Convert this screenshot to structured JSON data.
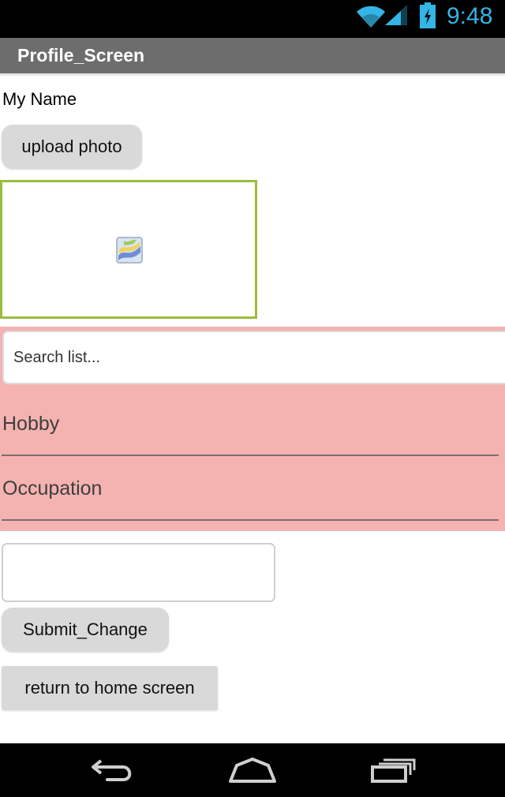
{
  "status_bar": {
    "time": "9:48",
    "icons": [
      "wifi-icon",
      "signal-icon",
      "battery-icon"
    ],
    "accent_color": "#33b5e5"
  },
  "title_bar": {
    "title": "Profile_Screen",
    "background": "#6d6d6d"
  },
  "profile": {
    "name_label": "My Name",
    "upload_button_label": "upload photo",
    "image_placeholder_icon": "broken-image-icon",
    "image_border_color": "#9cbd3c"
  },
  "list_view": {
    "background": "#f4b3b1",
    "search_placeholder": "Search list...",
    "search_value": "",
    "items": [
      {
        "label": "Hobby"
      },
      {
        "label": "Occupation"
      }
    ]
  },
  "edit": {
    "text_field_value": "",
    "submit_button_label": "Submit_Change",
    "return_button_label": "return to home screen"
  },
  "nav_bar": {
    "icons": [
      "back-icon",
      "home-icon",
      "recent-apps-icon"
    ]
  }
}
